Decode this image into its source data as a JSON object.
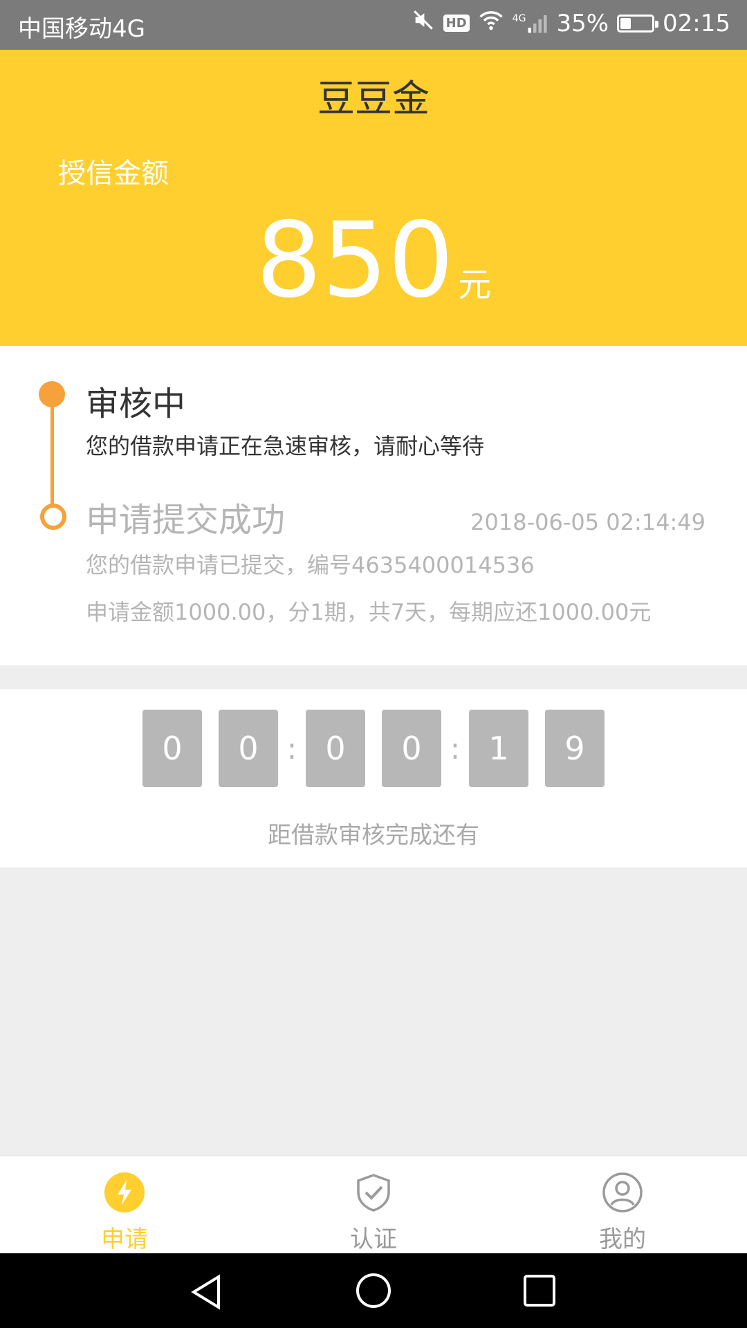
{
  "status_bar": {
    "carrier": "中国移动4G",
    "hd_badge": "HD",
    "network": "4G",
    "battery_percent": "35%",
    "battery_level": 0.35,
    "time": "02:15"
  },
  "header": {
    "title": "豆豆金",
    "credit_label": "授信金额",
    "amount": "850",
    "amount_unit": "元",
    "background_color": "#fecf2e"
  },
  "timeline": {
    "accent_color": "#f7a13a",
    "steps": [
      {
        "title": "审核中",
        "description": "您的借款申请正在急速审核，请耐心等待"
      },
      {
        "title": "申请提交成功",
        "timestamp": "2018-06-05 02:14:49",
        "description_1": "您的借款申请已提交，编号4635400014536",
        "description_2": "申请金额1000.00，分1期，共7天，每期应还1000.00元"
      }
    ]
  },
  "countdown": {
    "digits": [
      "0",
      "0",
      "0",
      "0",
      "1",
      "9"
    ],
    "separator": ":",
    "caption": "距借款审核完成还有"
  },
  "bottom_nav": {
    "active_color": "#fecf2e",
    "inactive_color": "#999999",
    "items": [
      {
        "label": "申请",
        "icon": "lightning-icon",
        "active": true
      },
      {
        "label": "认证",
        "icon": "shield-check-icon",
        "active": false
      },
      {
        "label": "我的",
        "icon": "user-icon",
        "active": false
      }
    ]
  },
  "system_nav": {
    "buttons": [
      "back-icon",
      "home-icon",
      "recents-icon"
    ]
  }
}
